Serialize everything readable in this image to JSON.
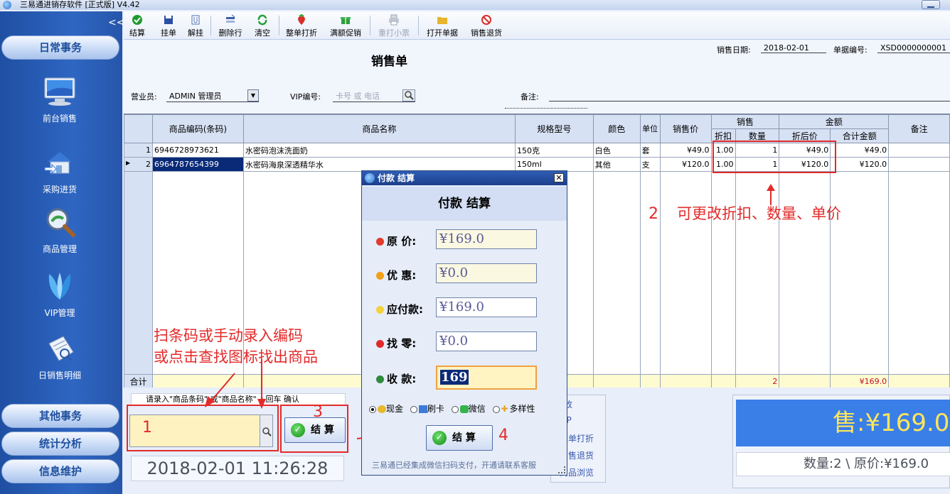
{
  "app": {
    "title": "三易通进销存软件 [正式版] V4.42"
  },
  "sidebar": {
    "collapse": "<<",
    "top_category": "日常事务",
    "items": [
      {
        "label": "前台销售",
        "icon": "monitor-icon"
      },
      {
        "label": "采购进货",
        "icon": "house-icon"
      },
      {
        "label": "商品管理",
        "icon": "magnifier-icon"
      },
      {
        "label": "VIP管理",
        "icon": "vip-icon"
      },
      {
        "label": "日销售明细",
        "icon": "report-icon"
      }
    ],
    "bottom_categories": [
      "其他事务",
      "统计分析",
      "信息维护"
    ]
  },
  "toolbar": {
    "items": [
      {
        "label": "结算",
        "icon": "check-icon",
        "color": "#1f9b2c"
      },
      {
        "label": "挂单",
        "icon": "floppy-icon",
        "color": "#2c4fa6"
      },
      {
        "label": "解挂",
        "icon": "clip-icon",
        "color": "#4b6fb0"
      },
      {
        "label": "删除行",
        "icon": "delete-row-icon",
        "color": "#3b5ea8"
      },
      {
        "label": "清空",
        "icon": "refresh-icon",
        "color": "#23a039"
      },
      {
        "label": "整单打折",
        "icon": "strawberry-icon",
        "color": "#d8302a"
      },
      {
        "label": "满额促销",
        "icon": "gift-icon",
        "color": "#25a04a"
      },
      {
        "label": "重打小票",
        "icon": "printer-icon",
        "color": "#9aa4b4",
        "disabled": true
      },
      {
        "label": "打开单据",
        "icon": "folder-icon",
        "color": "#e7b52b"
      },
      {
        "label": "销售退货",
        "icon": "return-icon",
        "color": "#d8302a"
      }
    ]
  },
  "header": {
    "title": "销售单",
    "sale_date_label": "销售日期:",
    "sale_date": "2018-02-01",
    "doc_no_label": "单据编号:",
    "doc_no": "XSD0000000001",
    "clerk_label": "营业员:",
    "clerk_value": "ADMIN 管理员",
    "vip_label": "VIP编号:",
    "vip_placeholder": "卡号 或 电话",
    "note_label": "备注:"
  },
  "grid": {
    "headers": {
      "code": "商品编码(条码)",
      "name": "商品名称",
      "spec": "规格型号",
      "color": "颜色",
      "unit": "单位",
      "price": "销售价",
      "sale_group": "销售",
      "discount": "折扣",
      "qty": "数量",
      "amount_group": "金额",
      "disc_price": "折后价",
      "total": "合计金额",
      "note": "备注"
    },
    "rows": [
      {
        "no": "1",
        "code": "6946728973621",
        "name": "水密码泡沫洗面奶",
        "spec": "150克",
        "color": "白色",
        "unit": "套",
        "price": "¥49.0",
        "discount": "1.00",
        "qty": "1",
        "disc_price": "¥49.0",
        "total": "¥49.0"
      },
      {
        "no": "2",
        "code": "6964787654399",
        "name": "水密码海泉深透精华水",
        "spec": "150ml",
        "color": "其他",
        "unit": "支",
        "price": "¥120.0",
        "discount": "1.00",
        "qty": "1",
        "disc_price": "¥120.0",
        "total": "¥120.0"
      }
    ],
    "footer": {
      "label": "合计",
      "qty": "2",
      "total": "¥169.0"
    }
  },
  "bottom": {
    "input_hint": "请录入\"商品条码\" 或\"商品名称\" +回车 确认",
    "input_value": "",
    "settle_button": "结 算",
    "datetime": "2018-02-01 11:26:28",
    "side_links": [
      "改",
      "IP",
      "整单打折",
      "销售退货",
      "商品浏览"
    ],
    "big_total": "售:¥169.0",
    "summary": "数量:2 \\ 原价:¥169.0"
  },
  "annotations": {
    "scan_text_line1": "扫条码或手动录入编码",
    "scan_text_line2": "或点击查找图标找出商品",
    "edit_hint": "可更改折扣、数量、单价",
    "n1": "1",
    "n2": "2",
    "n3": "3",
    "n4": "4"
  },
  "dialog": {
    "title": "付款 结算",
    "heading": "付款 结算",
    "original_label": "原  价:",
    "original_value": "¥169.0",
    "discount_label": "优  惠:",
    "discount_value": "¥0.0",
    "payable_label": "应付款:",
    "payable_value": "¥169.0",
    "change_label": "找  零:",
    "change_value": "¥0.0",
    "received_label": "收  款:",
    "received_value": "169",
    "payment_methods": [
      "现金",
      "刷卡",
      "微信",
      "多样性"
    ],
    "selected_method": "现金",
    "settle_button": "结 算",
    "footer_text": "三易通已经集成微信扫码支付，开通请联系客服"
  }
}
